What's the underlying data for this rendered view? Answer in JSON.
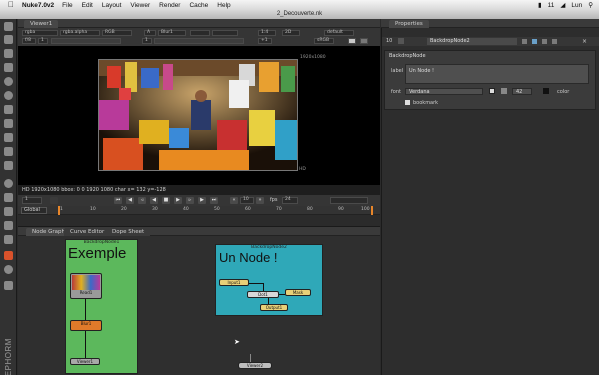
{
  "menubar": {
    "app": "Nuke7.0v2",
    "items": [
      "File",
      "Edit",
      "Layout",
      "Viewer",
      "Render",
      "Cache",
      "Help"
    ],
    "battery": "11",
    "time": "Lun"
  },
  "window": {
    "title": "2_Decouverte.nk"
  },
  "viewer": {
    "tab": "Viewer1",
    "channels": "rgba",
    "alpha": "rgba.alpha",
    "colorspace": "RGB",
    "input_a": "A",
    "input_a_node": "Blur1",
    "fstop": "f/8",
    "frame_rate": "1",
    "gain_label": "1",
    "gamma_label": "1",
    "y_label": "Y",
    "proxy": "1:4",
    "view_mode": "2D",
    "lut": "default",
    "zoom": "+1",
    "roi": "sRGB",
    "format_label": "HD",
    "format_label_top": "1920x1080",
    "info": "HD 1920x1080  bbox: 0 0 1920 1080  char  x= 132 y=-128"
  },
  "transport": {
    "frame": "1",
    "fps_label": "fps",
    "fps": "24",
    "end_frame": "10",
    "increment": "1"
  },
  "timeline": {
    "scope": "Global",
    "ticks": [
      "1",
      "10",
      "20",
      "30",
      "40",
      "50",
      "60",
      "70",
      "80",
      "90",
      "100"
    ]
  },
  "nodegraph": {
    "tabs": [
      "Node Graph",
      "Curve Editor",
      "Dope Sheet"
    ],
    "backdrop1": {
      "title": "BackdropNode1",
      "label": "Exemple",
      "color": "#5cb85c"
    },
    "backdrop2": {
      "title": "BackdropNode2",
      "label": "Un Node !",
      "color": "#2fa8b8"
    },
    "nodes": {
      "read": "Read1",
      "read_sub": "2_Decouverte_A.exr",
      "blur": "Blur1",
      "blur_sub": "(all)",
      "viewer1": "Viewer1",
      "viewer2": "Viewer2",
      "input": "Input1",
      "dot": "Dot1",
      "mask": "Mask",
      "output": "Output1"
    }
  },
  "properties": {
    "tab": "Properties",
    "bar_count": "10",
    "node_name": "BackdropNode2",
    "panel_title": "BackdropNode",
    "label_label": "label",
    "label_value": "Un Node !",
    "font_label": "font",
    "font_value": "Verdana",
    "size_value": "42",
    "color_label": "color",
    "bookmark_label": "bookmark"
  }
}
